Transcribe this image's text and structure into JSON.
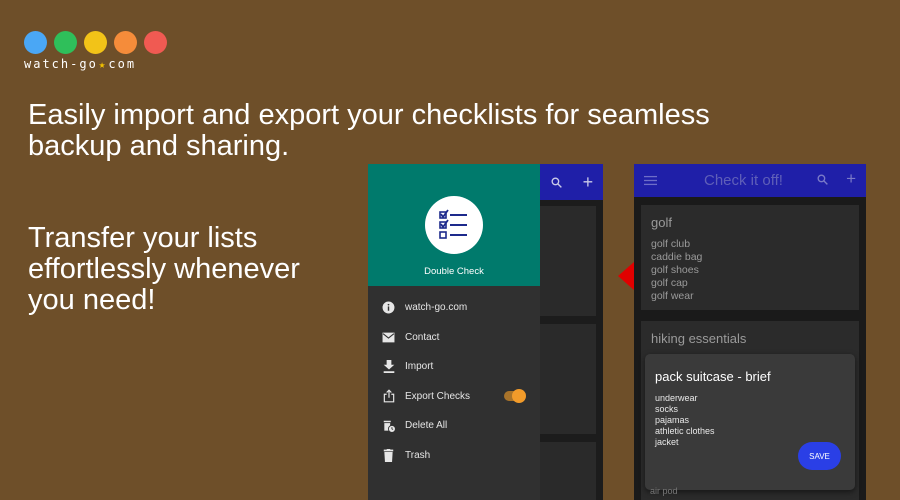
{
  "logo": {
    "text_left": "watch-go",
    "text_right": "com",
    "dot_colors": [
      "#4aa7f5",
      "#2fbf5a",
      "#f2c318",
      "#f58c3a",
      "#f05a52"
    ]
  },
  "headline": "Easily import and export your checklists for seamless backup and sharing.",
  "subhead": "Transfer your lists effortlessly whenever you need!",
  "drawer": {
    "app_name": "Double Check",
    "menu": [
      {
        "label": "watch-go.com",
        "icon": "info-icon"
      },
      {
        "label": "Contact",
        "icon": "mail-icon"
      },
      {
        "label": "Import",
        "icon": "download-icon"
      },
      {
        "label": "Export Checks",
        "icon": "share-icon",
        "toggle_on": true
      },
      {
        "label": "Delete All",
        "icon": "delete-clock-icon"
      },
      {
        "label": "Trash",
        "icon": "trash-icon"
      }
    ]
  },
  "phone2": {
    "title": "Check it off!",
    "lists": [
      {
        "title": "golf",
        "items": [
          "golf club",
          "caddie bag",
          "golf shoes",
          "golf cap",
          "golf wear"
        ]
      },
      {
        "title": "hiking essentials",
        "items": []
      }
    ],
    "dialog": {
      "title": "pack suitcase - brief",
      "items": [
        "underwear",
        "socks",
        "pajamas",
        "athletic clothes",
        "jacket"
      ],
      "save_label": "SAVE"
    },
    "peek_text": "air pod"
  },
  "colors": {
    "background": "#6e4f29",
    "drawer_header": "#007a6c",
    "toolbar": "#1f1fa8",
    "save_button": "#2a3fe6",
    "arrow": "#e00000",
    "toggle_knob": "#f29b2a"
  }
}
